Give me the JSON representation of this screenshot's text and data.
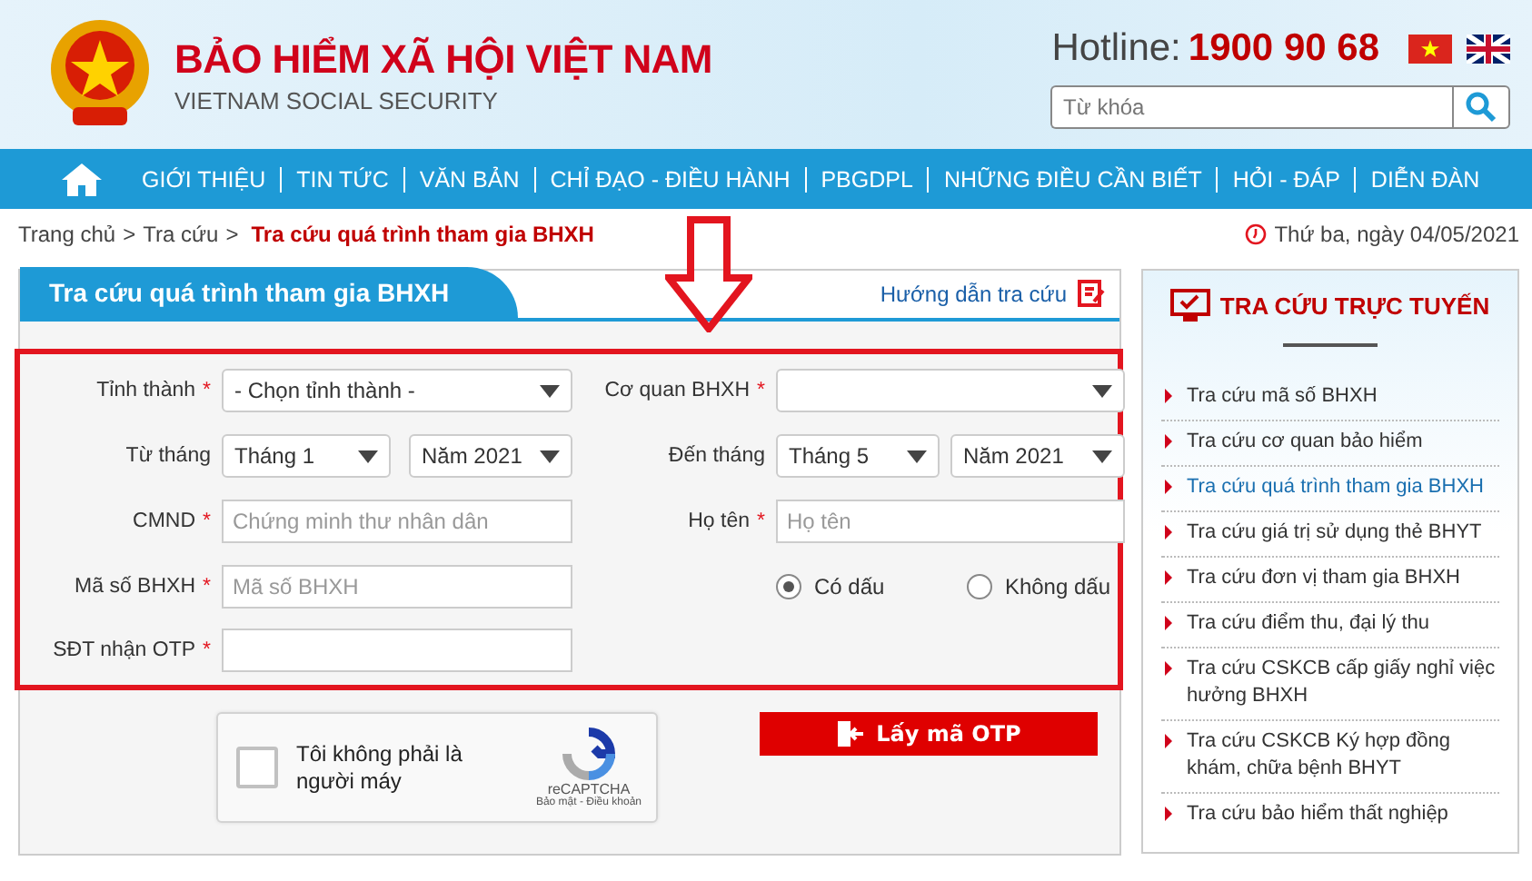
{
  "header": {
    "title": "BẢO HIỂM XÃ HỘI VIỆT NAM",
    "subtitle": "VIETNAM SOCIAL SECURITY",
    "hotline_label": "Hotline:",
    "hotline_number": "1900 90 68",
    "search": {
      "placeholder": "Từ khóa"
    }
  },
  "nav": {
    "items": [
      "GIỚI THIỆU",
      "TIN TỨC",
      "VĂN BẢN",
      "CHỈ ĐẠO - ĐIỀU HÀNH",
      "PBGDPL",
      "NHỮNG ĐIỀU CẦN BIẾT",
      "HỎI - ĐÁP",
      "DIỄN ĐÀN"
    ]
  },
  "breadcrumb": {
    "items": [
      "Trang chủ",
      "Tra cứu"
    ],
    "separator": ">",
    "current": "Tra cứu quá trình tham gia BHXH"
  },
  "date": "Thứ ba, ngày 04/05/2021",
  "panel": {
    "title": "Tra cứu quá trình tham gia BHXH",
    "help_link": "Hướng dẫn tra cứu"
  },
  "form": {
    "required_mark": "*",
    "province": {
      "label": "Tỉnh thành",
      "required": true,
      "value": "- Chọn tỉnh thành -"
    },
    "office": {
      "label": "Cơ quan BHXH",
      "required": true
    },
    "from": {
      "label": "Từ tháng",
      "month": "Tháng 1",
      "year": "Năm 2021"
    },
    "to": {
      "label": "Đến tháng",
      "month": "Tháng 5",
      "year": "Năm 2021"
    },
    "id_card": {
      "label": "CMND",
      "required": true,
      "placeholder": "Chứng minh thư nhân dân"
    },
    "full_name": {
      "label": "Họ tên",
      "required": true,
      "placeholder": "Họ tên"
    },
    "insurance_no": {
      "label": "Mã số BHXH",
      "required": true,
      "placeholder": "Mã số BHXH"
    },
    "accent_options": [
      {
        "label": "Có dấu",
        "selected": true
      },
      {
        "label": "Không dấu",
        "selected": false
      }
    ],
    "otp_phone": {
      "label": "SĐT nhận OTP",
      "required": true
    },
    "captcha": {
      "label": "Tôi không phải là người máy",
      "checked": false,
      "brand": "reCAPTCHA",
      "terms": "Bảo mật - Điều khoản"
    },
    "otp_button": "Lấy mã OTP"
  },
  "sidebar": {
    "title": "TRA CỨU TRỰC TUYẾN",
    "items": [
      {
        "label": "Tra cứu mã số BHXH",
        "selected": false
      },
      {
        "label": "Tra cứu cơ quan bảo hiểm",
        "selected": false
      },
      {
        "label": "Tra cứu quá trình tham gia BHXH",
        "selected": true
      },
      {
        "label": "Tra cứu giá trị sử dụng thẻ BHYT",
        "selected": false
      },
      {
        "label": "Tra cứu đơn vị tham gia BHXH",
        "selected": false
      },
      {
        "label": "Tra cứu điểm thu, đại lý thu",
        "selected": false
      },
      {
        "label": "Tra cứu CSKCB cấp giấy nghỉ việc hưởng BHXH",
        "selected": false
      },
      {
        "label": "Tra cứu CSKCB Ký hợp đồng khám, chữa bệnh BHYT",
        "selected": false
      },
      {
        "label": "Tra cứu bảo hiểm thất nghiệp",
        "selected": false
      }
    ]
  }
}
